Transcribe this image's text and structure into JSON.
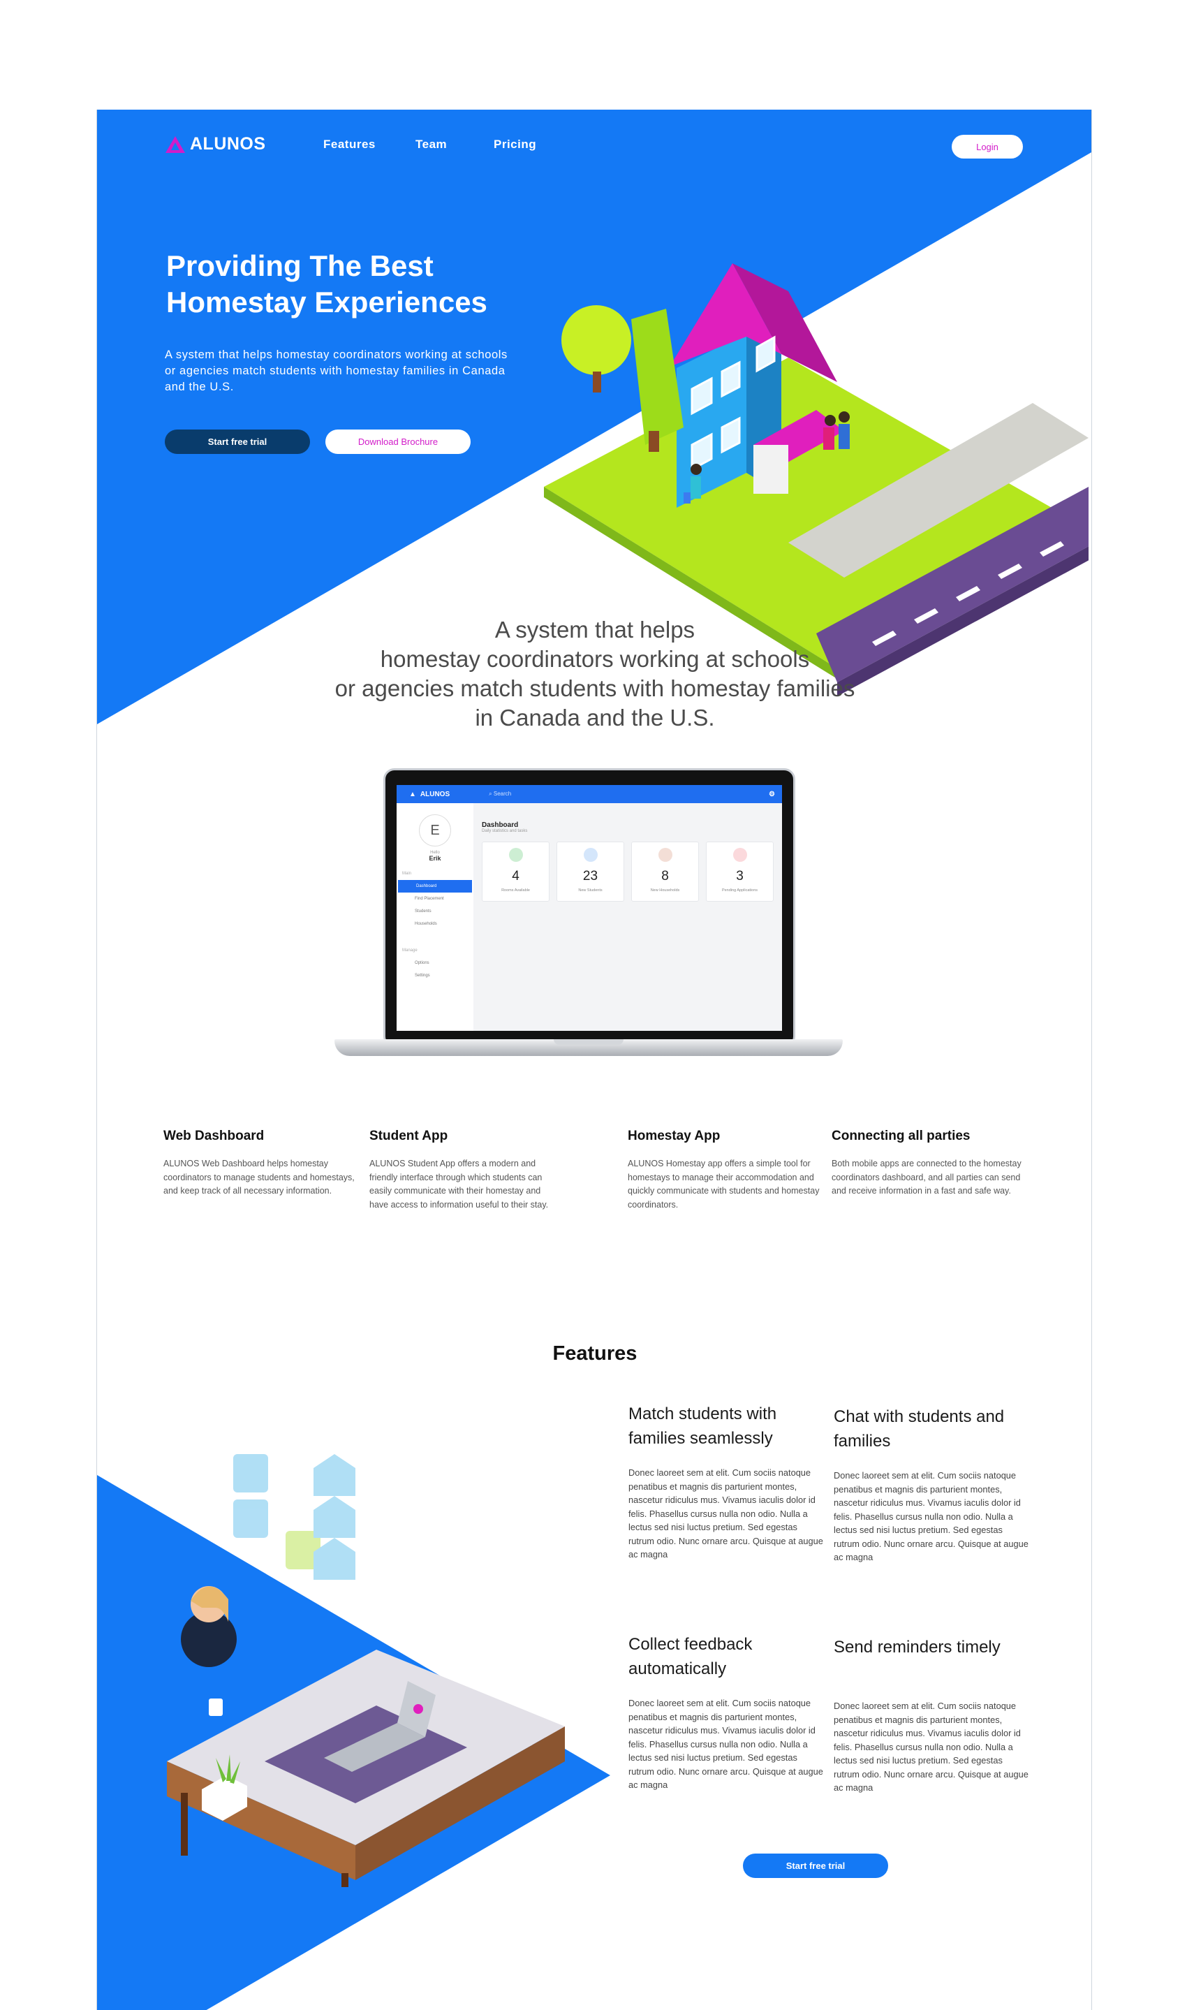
{
  "brand": {
    "name": "ALUNOS",
    "accent": "#1479f5",
    "magenta": "#d21cc9",
    "dark_button": "#093c6c"
  },
  "nav": {
    "links": [
      "Features",
      "Team",
      "Pricing"
    ],
    "login_label": "Login"
  },
  "hero": {
    "title_line1": "Providing The Best",
    "title_line2": "Homestay Experiences",
    "subtitle": "A system that helps homestay coordinators working at schools or agencies match students with homestay families in Canada and the U.S.",
    "primary_cta": "Start free trial",
    "secondary_cta": "Download Brochure"
  },
  "tagline": {
    "line1": "A system that helps",
    "line2": "homestay coordinators working at schools",
    "line3": "or agencies match students with homestay families",
    "line4": "in Canada and the U.S."
  },
  "dashboard_preview": {
    "brand": "ALUNOS",
    "search_placeholder": "Search",
    "greeting": "Hello",
    "user_initial": "E",
    "user_name": "Erik",
    "menu_section": "Main",
    "menu": [
      "Dashboard",
      "Find Placement",
      "Students",
      "Households"
    ],
    "manage_section": "Manage",
    "manage": [
      "Options",
      "Settings"
    ],
    "title": "Dashboard",
    "subtitle": "Daily statistics and tasks",
    "stats": [
      {
        "value": "4",
        "label": "Rooms Available",
        "color": "#cdeed3"
      },
      {
        "value": "23",
        "label": "New Students",
        "color": "#d4e6fb"
      },
      {
        "value": "8",
        "label": "New Households",
        "color": "#f3ded6"
      },
      {
        "value": "3",
        "label": "Pending Applications",
        "color": "#fbd9dc"
      }
    ]
  },
  "products": [
    {
      "title": "Web Dashboard",
      "text": "ALUNOS Web Dashboard helps homestay coordinators to manage students and homestays, and keep track of all necessary information."
    },
    {
      "title": "Student App",
      "text": "ALUNOS Student App offers a modern and friendly interface through which students can easily communicate with their homestay and have access to information useful to their stay."
    },
    {
      "title": "Homestay App",
      "text": "ALUNOS Homestay app offers a simple tool for homestays to manage their accommodation and quickly communicate with students and homestay coordinators."
    },
    {
      "title": "Connecting all parties",
      "text": "Both mobile apps are connected to the homestay coordinators dashboard, and all parties can send and receive information in a fast and safe way."
    }
  ],
  "features": {
    "heading": "Features",
    "items": [
      {
        "title": "Match students with families seamlessly",
        "text": "Donec laoreet sem at elit. Cum sociis natoque penatibus et magnis dis parturient montes, nascetur ridiculus mus. Vivamus iaculis dolor id felis. Phasellus cursus nulla non odio. Nulla a lectus sed nisi luctus pretium. Sed egestas rutrum odio. Nunc ornare arcu. Quisque at augue ac magna"
      },
      {
        "title": "Chat with students and families",
        "text": "Donec laoreet sem at elit. Cum sociis natoque penatibus et magnis dis parturient montes, nascetur ridiculus mus. Vivamus iaculis dolor id felis. Phasellus cursus nulla non odio. Nulla a lectus sed nisi luctus pretium. Sed egestas rutrum odio. Nunc ornare arcu. Quisque at augue ac magna"
      },
      {
        "title": "Collect feedback automatically",
        "text": "Donec laoreet sem at elit. Cum sociis natoque penatibus et magnis dis parturient montes, nascetur ridiculus mus. Vivamus iaculis dolor id felis. Phasellus cursus nulla non odio. Nulla a lectus sed nisi luctus pretium. Sed egestas rutrum odio. Nunc ornare arcu. Quisque at augue ac magna"
      },
      {
        "title": "Send reminders timely",
        "text": "Donec laoreet sem at elit. Cum sociis natoque penatibus et magnis dis parturient montes, nascetur ridiculus mus. Vivamus iaculis dolor id felis. Phasellus cursus nulla non odio. Nulla a lectus sed nisi luctus pretium. Sed egestas rutrum odio. Nunc ornare arcu. Quisque at augue ac magna"
      }
    ],
    "cta": "Start free trial"
  }
}
